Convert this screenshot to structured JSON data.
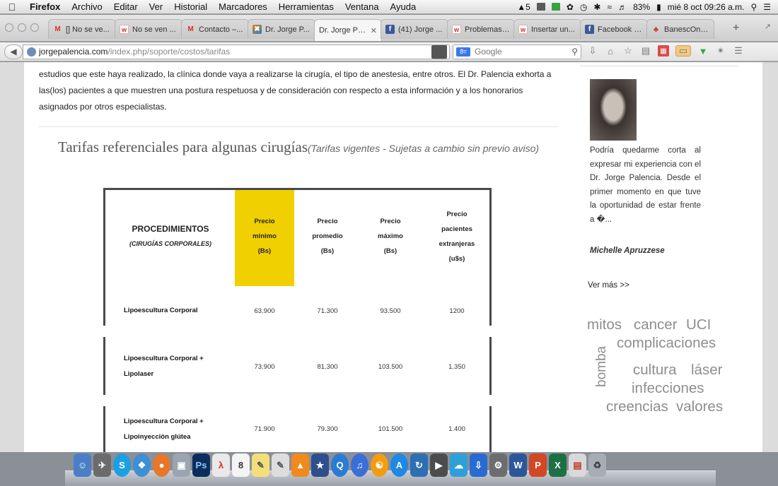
{
  "menubar": {
    "apple_icon": "apple-icon",
    "items": [
      "Firefox",
      "Archivo",
      "Editar",
      "Ver",
      "Historial",
      "Marcadores",
      "Herramientas",
      "Ventana",
      "Ayuda"
    ],
    "status": {
      "adobe_badge": "5",
      "battery": "83%",
      "clock": "mié 8 oct  09:26 a.m."
    }
  },
  "tabs": [
    {
      "title": "[] No se ve...",
      "icon": "gmail-icon"
    },
    {
      "title": "No se ven ...",
      "icon": "w-icon"
    },
    {
      "title": "Contacto –...",
      "icon": "gmail-icon"
    },
    {
      "title": "Dr. Jorge P...",
      "icon": "drjorge-icon"
    },
    {
      "title": "Dr. Jorge Pa...",
      "icon": "blank-icon",
      "active": true
    },
    {
      "title": "(41) Jorge ...",
      "icon": "facebook-icon"
    },
    {
      "title": "Problemas ...",
      "icon": "w-icon"
    },
    {
      "title": "Insertar un...",
      "icon": "w-icon"
    },
    {
      "title": "Facebook L...",
      "icon": "facebook-icon"
    },
    {
      "title": "BanescOnli...",
      "icon": "banesco-icon"
    }
  ],
  "navbar": {
    "url_domain": "jorgepalencia.com",
    "url_path": "/index.php/soporte/costos/tarifas",
    "search_placeholder": "Google",
    "search_engine_badge": "8"
  },
  "page": {
    "body_text": "estudios que este haya realizado, la clínica donde vaya a realizarse la cirugía, el tipo de anestesia, entre otros. El Dr. Palencia exhorta a las(los) pacientes a que muestren una postura respetuosa y de consideración con respecto a esta información y a los honorarios asignados por otros especialistas.",
    "heading": "Tarifas referenciales para algunas cirugías",
    "heading_note": "(Tarifas vigentes - Sujetas a cambio sin previo aviso)"
  },
  "table": {
    "proc_header": "PROCEDIMIENTOS",
    "proc_sub": "(CIRUGÍAS CORPORALES)",
    "columns": [
      [
        "Precio",
        "mínimo",
        "(Bs)"
      ],
      [
        "Precio",
        "promedio",
        "(Bs)"
      ],
      [
        "Precio",
        "máximo",
        "(Bs)"
      ],
      [
        "Precio",
        "pacientes",
        "extranjeras",
        "(u$s)"
      ]
    ],
    "rows": [
      {
        "name": [
          "Lipoescultura Corporal"
        ],
        "values": [
          "63.900",
          "71.300",
          "93.500",
          "1200"
        ]
      },
      {
        "name": [
          "Lipoescultura Corporal +",
          "Lipolaser"
        ],
        "values": [
          "73.900",
          "81.300",
          "103.500",
          "1.350"
        ]
      },
      {
        "name": [
          "Lipoescultura Corporal +",
          "Lipoinyección glútea"
        ],
        "values": [
          "71.900",
          "79.300",
          "101.500",
          "1.400"
        ]
      }
    ]
  },
  "sidebar": {
    "testimonial": "Podría quedarme corta al expresar mi experiencia con el Dr. Jorge Palencia. Desde el primer momento en que tuve la oportunidad de estar frente a �...",
    "author": "Michelle Apruzzese",
    "more_link": "Ver más >>",
    "tags": [
      "mitos",
      "cancer",
      "UCI",
      "complicaciones",
      "bomba",
      "cultura",
      "láser",
      "infecciones",
      "creencias",
      "valores"
    ]
  },
  "colors": {
    "highlight": "#f0d000",
    "table_border": "#4a4a4a",
    "tag_gray": "#8e8e8e"
  }
}
